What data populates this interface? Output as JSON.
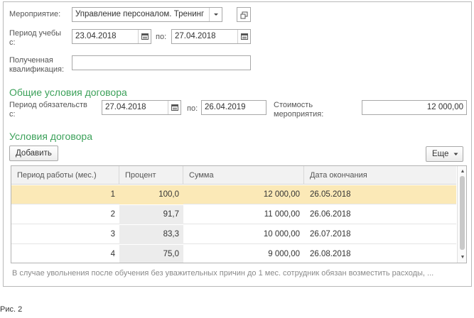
{
  "form": {
    "event_label": "Мероприятие:",
    "event_value": "Управление персоналом. Тренинг",
    "study_period_label_line1": "Период учебы",
    "study_period_label_line2": "с:",
    "study_from": "23.04.2018",
    "to_label": "по:",
    "study_to": "27.04.2018",
    "qualification_label_line1": "Полученная",
    "qualification_label_line2": "квалификация:",
    "qualification_value": ""
  },
  "general": {
    "title": "Общие условия договора",
    "obligation_label_line1": "Период обязательств",
    "obligation_label_line2": "с:",
    "obligation_from": "27.04.2018",
    "to_label": "по:",
    "obligation_to": "26.04.2019",
    "cost_label_line1": "Стоимость",
    "cost_label_line2": "мероприятия:",
    "cost_value": "12 000,00"
  },
  "conditions": {
    "title": "Условия договора",
    "add_button": "Добавить",
    "more_button": "Еще",
    "columns": [
      "Период работы (мес.)",
      "Процент",
      "Сумма",
      "Дата окончания"
    ],
    "rows": [
      {
        "period": "1",
        "percent": "100,0",
        "sum": "12 000,00",
        "date": "26.05.2018"
      },
      {
        "period": "2",
        "percent": "91,7",
        "sum": "11 000,00",
        "date": "26.06.2018"
      },
      {
        "period": "3",
        "percent": "83,3",
        "sum": "10 000,00",
        "date": "26.07.2018"
      },
      {
        "period": "4",
        "percent": "75,0",
        "sum": "9 000,00",
        "date": "26.08.2018"
      }
    ]
  },
  "footer_text": "В случае увольнения после обучения без уважительных причин до 1 мес. сотрудник обязан возместить расходы, ...",
  "caption": "Рис. 2",
  "icons": {
    "dropdown": "chevron-down-icon",
    "open": "open-window-icon",
    "calendar": "calendar-icon"
  }
}
